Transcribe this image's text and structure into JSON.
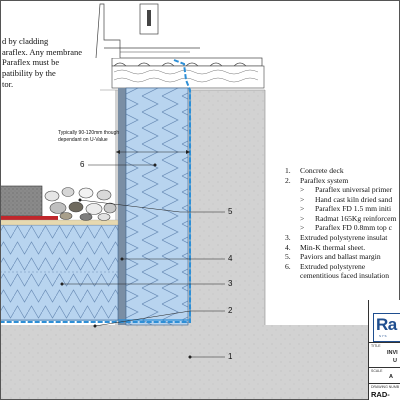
{
  "top_note": {
    "lines": [
      "d by cladding",
      "araflex. Any membrane",
      " Paraflex must be",
      "patibility by the",
      "tor."
    ]
  },
  "dimension_note": {
    "lines": [
      "Typically 90-120mm though",
      "dependant on U-Value"
    ]
  },
  "callouts": [
    "1",
    "2",
    "3",
    "4",
    "5",
    "6"
  ],
  "legend": {
    "items": [
      {
        "num": "1.",
        "text": "Concrete deck"
      },
      {
        "num": "2.",
        "text": "Paraflex system"
      },
      {
        "num": ">",
        "text": "Paraflex universal primer"
      },
      {
        "num": ">",
        "text": "Hand cast kiln dried sand"
      },
      {
        "num": ">",
        "text": "Paraflex FD 1.5 mm initi"
      },
      {
        "num": ">",
        "text": "Radmat 165Kg reinforcem"
      },
      {
        "num": ">",
        "text": "Paraflex FD 0.8mm top c"
      },
      {
        "num": "3.",
        "text": "Extruded polystyrene insulat"
      },
      {
        "num": "4.",
        "text": "Min-K thermal sheet."
      },
      {
        "num": "5.",
        "text": "Paviors and ballast margin"
      },
      {
        "num": "6.",
        "text": "Extruded polystyrene"
      }
    ],
    "continuation": "cementitious faced insulation"
  },
  "title_block": {
    "logo_text": "Ra",
    "logo_subtext": "S Y S",
    "title_label": "TITLE",
    "title_line1": "INVI",
    "title_line2": "U",
    "scale_label": "SCALE",
    "scale_value": "A",
    "drawing_label": "DRAWING NUMB",
    "drawing_number": "RAD-"
  },
  "colors": {
    "insulation": "#b8d4ef",
    "insulation_stroke": "#6d8fb8",
    "membrane": "#2e8fd6",
    "concrete": "#d2d2d2",
    "paver": "#7a7a7a",
    "red_layer": "#c0262b",
    "brand_blue": "#1f4e8f"
  }
}
